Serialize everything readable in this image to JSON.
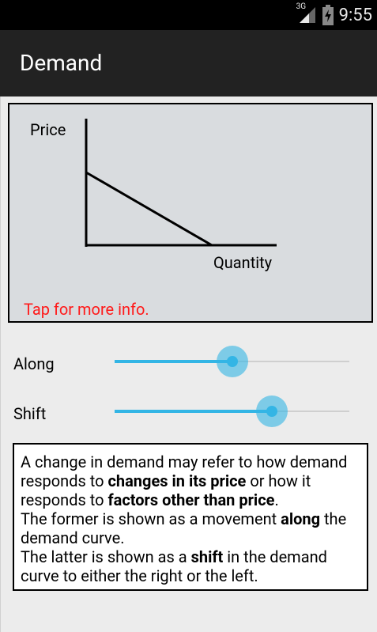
{
  "status_bar": {
    "network": "3G",
    "time": "9:55",
    "icons": [
      "signal-icon",
      "battery-charging-icon"
    ]
  },
  "app_bar": {
    "title": "Demand"
  },
  "graph": {
    "y_label": "Price",
    "x_label": "Quantity",
    "link_text": "Tap for more info."
  },
  "sliders": [
    {
      "label": "Along",
      "value_fraction": 0.5
    },
    {
      "label": "Shift",
      "value_fraction": 0.67
    }
  ],
  "description": {
    "p1_a": "A change in demand may refer to how demand responds to ",
    "p1_b": "changes in its price",
    "p1_c": " or how it responds to ",
    "p1_d": "factors other than price",
    "p1_e": ".",
    "p2_a": "The former is shown as a movement ",
    "p2_b": "along",
    "p2_c": " the demand curve.",
    "p3_a": "The latter is shown as a ",
    "p3_b": "shift",
    "p3_c": " in the demand curve to either the right or the left."
  },
  "colors": {
    "accent": "#33b5e5",
    "link": "#ff1a1a",
    "action_bar": "#222222",
    "graph_bg": "#d9dcdf"
  }
}
